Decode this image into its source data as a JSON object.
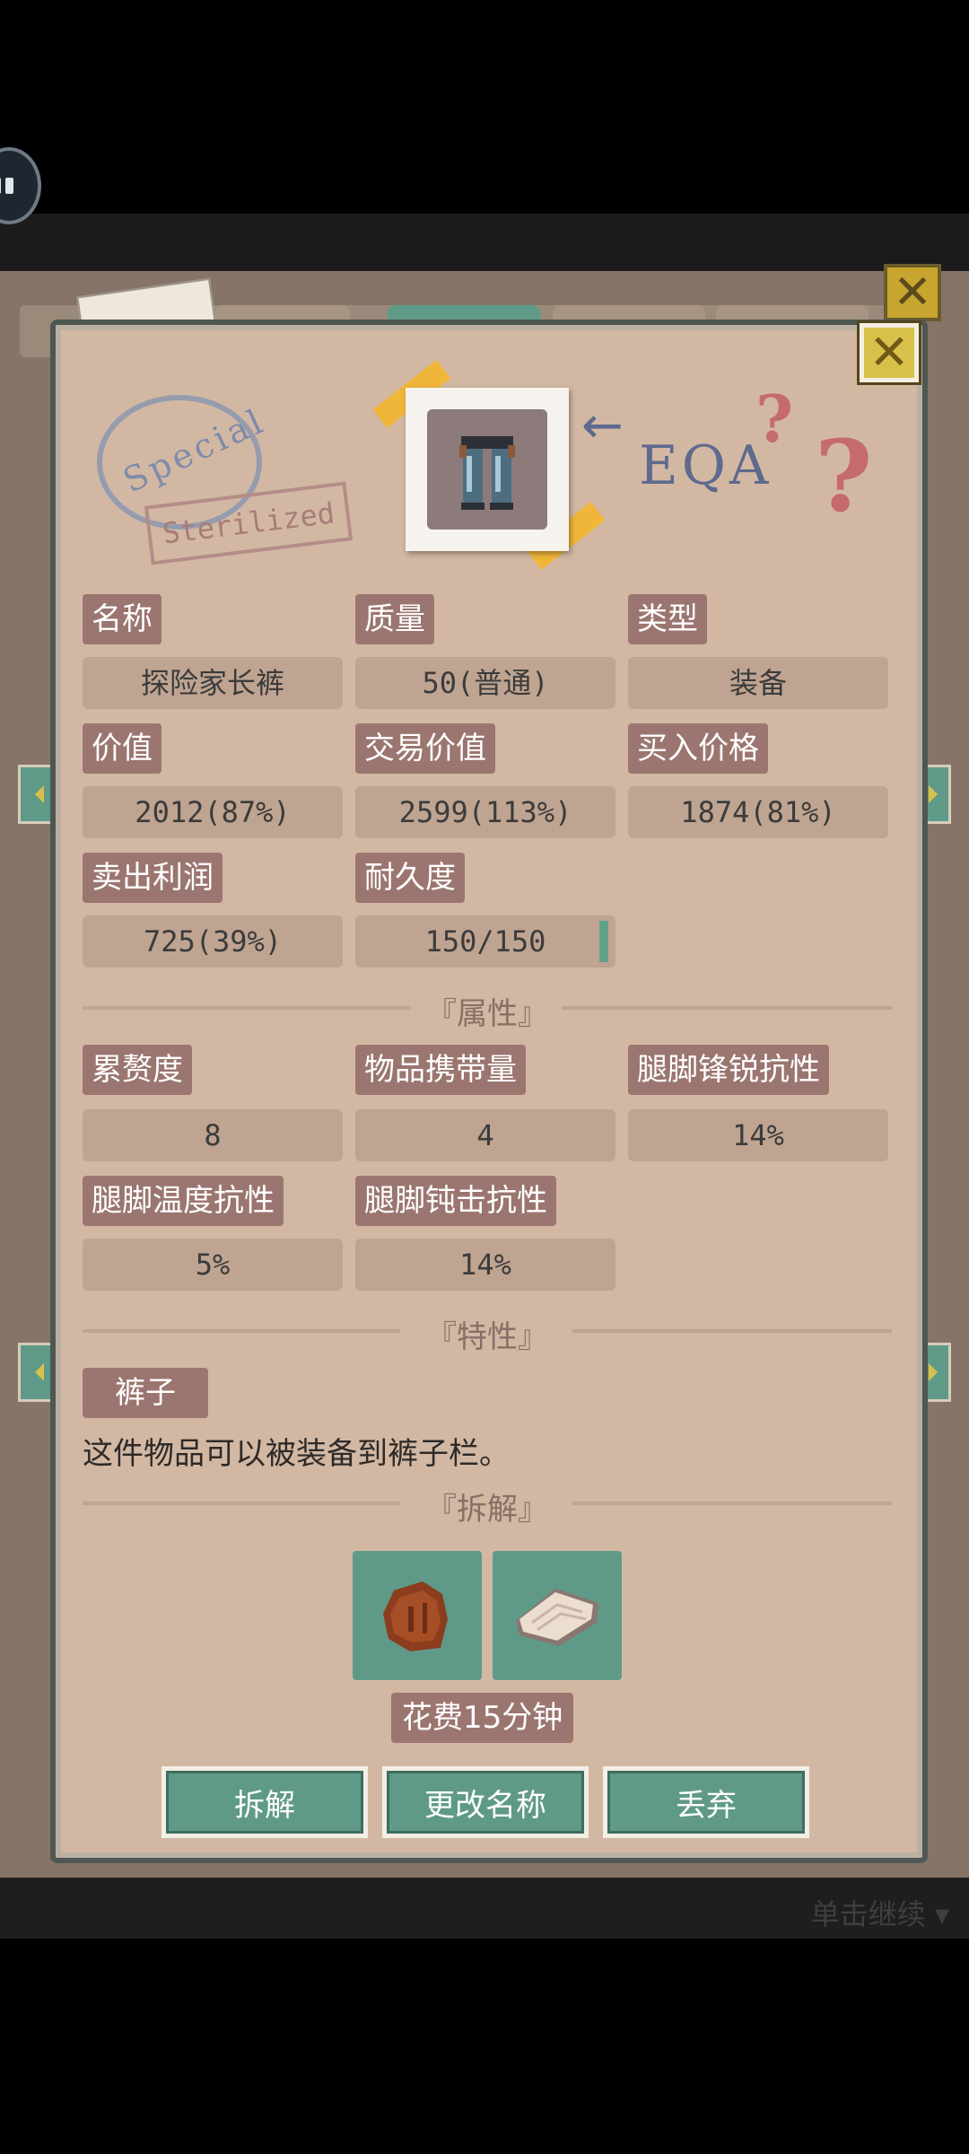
{
  "item": {
    "name_label": "名称",
    "name_value": "探险家长裤",
    "quality_label": "质量",
    "quality_value": "50(普通)",
    "type_label": "类型",
    "type_value": "装备",
    "value_label": "价值",
    "value_value": "2012(87%)",
    "trade_label": "交易价值",
    "trade_value": "2599(113%)",
    "buy_label": "买入价格",
    "buy_value": "1874(81%)",
    "profit_label": "卖出利润",
    "profit_value": "725(39%)",
    "durability_label": "耐久度",
    "durability_value": "150/150",
    "durability_fraction": 1.0
  },
  "sections": {
    "attributes": "『属性』",
    "traits": "『特性』",
    "dismantle": "『拆解』"
  },
  "attributes": {
    "encumbrance_label": "累赘度",
    "encumbrance_value": "8",
    "capacity_label": "物品携带量",
    "capacity_value": "4",
    "sharp_label": "腿脚锋锐抗性",
    "sharp_value": "14%",
    "temp_label": "腿脚温度抗性",
    "temp_value": "5%",
    "blunt_label": "腿脚钝击抗性",
    "blunt_value": "14%"
  },
  "trait": {
    "tag": "裤子",
    "description": "这件物品可以被装备到裤子栏。"
  },
  "dismantle": {
    "materials": [
      "leather-scrap-icon",
      "cloth-scrap-icon"
    ],
    "cost": "花费15分钟"
  },
  "actions": {
    "dismantle": "拆解",
    "rename": "更改名称",
    "discard": "丢弃"
  },
  "footer": {
    "continue_hint": "单击继续"
  },
  "decor": {
    "stamp_special": "Special",
    "stamp_sterilized": "Sterilized",
    "eqa": "EQA"
  },
  "colors": {
    "panel": "#d2b8a3",
    "label_bg": "#9b7670",
    "value_bg": "#bfa491",
    "accent_teal": "#5f9a88",
    "close_yellow": "#d9c04a"
  }
}
